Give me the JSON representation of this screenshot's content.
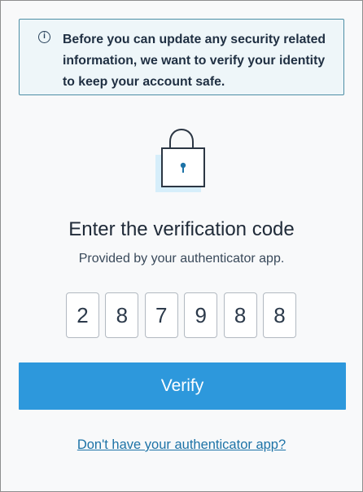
{
  "info_banner": {
    "icon": "info-icon",
    "icon_glyph": "i",
    "message": "Before you can update any security related information, we want to verify your identity to keep your account safe."
  },
  "lock_illustration": {
    "icon": "padlock-icon"
  },
  "verification": {
    "title": "Enter the verification code",
    "subtitle": "Provided by your authenticator app.",
    "code_digits": [
      "2",
      "8",
      "7",
      "9",
      "8",
      "8"
    ]
  },
  "actions": {
    "verify_label": "Verify",
    "help_link_label": "Don't have your authenticator app?"
  },
  "colors": {
    "accent": "#2d98dc",
    "banner_background": "#eef6f9",
    "banner_border": "#4d8ea5",
    "link": "#1d73a7",
    "page_background": "#f8f9fa"
  }
}
